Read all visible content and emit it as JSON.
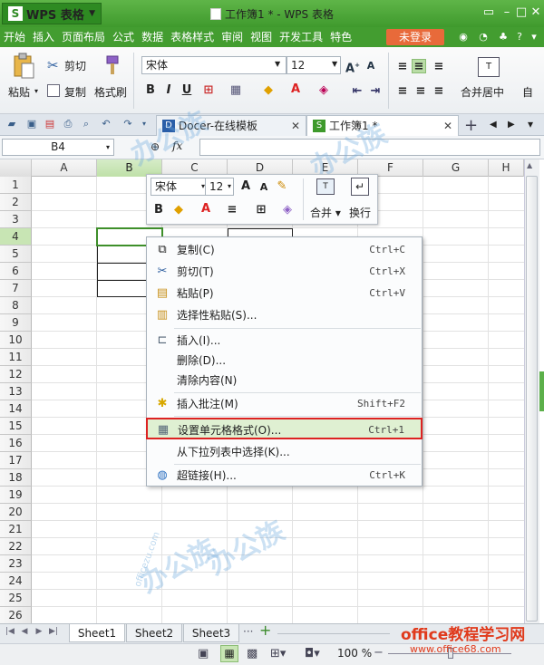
{
  "app": {
    "name": "WPS 表格",
    "logo": "S",
    "window_title": "工作簿1 * - WPS 表格"
  },
  "menubar": {
    "items": [
      "开始",
      "插入",
      "页面布局",
      "公式",
      "数据",
      "表格样式",
      "审阅",
      "视图",
      "开发工具",
      "特色"
    ],
    "login": "未登录"
  },
  "ribbon": {
    "paste": "粘贴",
    "cut": "剪切",
    "copy": "复制",
    "format_painter": "格式刷",
    "font": "宋体",
    "size": "12",
    "merge": "合并居中",
    "auto": "自"
  },
  "doctabs": [
    {
      "label": "Docer-在线模板"
    },
    {
      "label": "工作簿1 *"
    }
  ],
  "formula": {
    "namebox": "B4",
    "fx": "fx",
    "content": ""
  },
  "columns": [
    "A",
    "B",
    "C",
    "D",
    "E",
    "F",
    "G",
    "H"
  ],
  "rows": [
    "1",
    "2",
    "3",
    "4",
    "5",
    "6",
    "7",
    "8",
    "9",
    "10",
    "11",
    "12",
    "13",
    "14",
    "15",
    "16",
    "17",
    "18",
    "19",
    "20",
    "21",
    "22",
    "23",
    "24",
    "25",
    "26"
  ],
  "selected": {
    "col": "B",
    "row": "4"
  },
  "mini_toolbar": {
    "font": "宋体",
    "size": "12",
    "merge": "合并",
    "wrap": "换行"
  },
  "context_menu": [
    {
      "label": "复制(C)",
      "shortcut": "Ctrl+C",
      "icon": "copy-icon"
    },
    {
      "label": "剪切(T)",
      "shortcut": "Ctrl+X",
      "icon": "cut-icon"
    },
    {
      "label": "粘贴(P)",
      "shortcut": "Ctrl+V",
      "icon": "paste-icon"
    },
    {
      "label": "选择性粘贴(S)...",
      "shortcut": "",
      "icon": "paste-special-icon"
    },
    {
      "label": "插入(I)...",
      "shortcut": "",
      "icon": "insert-icon"
    },
    {
      "label": "删除(D)...",
      "shortcut": "",
      "icon": ""
    },
    {
      "label": "清除内容(N)",
      "shortcut": "",
      "icon": ""
    },
    {
      "label": "插入批注(M)",
      "shortcut": "Shift+F2",
      "icon": "comment-icon"
    },
    {
      "label": "设置单元格格式(O)...",
      "shortcut": "Ctrl+1",
      "icon": "format-cells-icon"
    },
    {
      "label": "从下拉列表中选择(K)...",
      "shortcut": "",
      "icon": ""
    },
    {
      "label": "超链接(H)...",
      "shortcut": "Ctrl+K",
      "icon": "hyperlink-icon"
    }
  ],
  "sheets": [
    "Sheet1",
    "Sheet2",
    "Sheet3"
  ],
  "status": {
    "zoom": "100 %"
  },
  "watermark": {
    "brand": "office教程学习网",
    "url": "www.office68.com",
    "text": "办公族",
    "domain": "officezu.com"
  }
}
